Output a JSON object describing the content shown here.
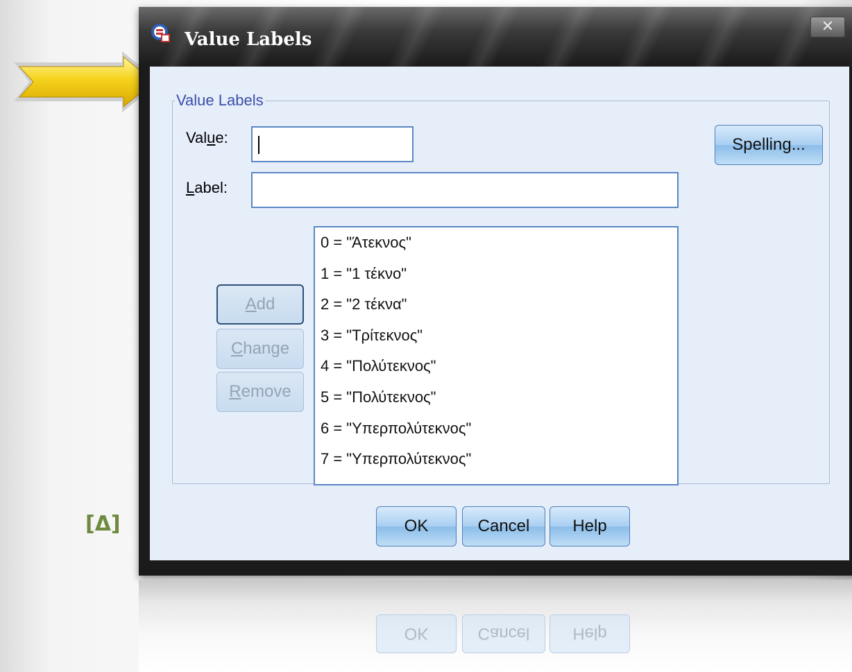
{
  "window": {
    "title": "Value Labels",
    "close_glyph": "✕",
    "icon": "spss-app-icon"
  },
  "group": {
    "legend": "Value Labels"
  },
  "value_field": {
    "label_prefix": "Val",
    "label_accel": "u",
    "label_suffix": "e:",
    "value": ""
  },
  "label_field": {
    "label_accel": "L",
    "label_rest": "abel:",
    "value": ""
  },
  "spelling_button": "Spelling...",
  "side_buttons": {
    "add": {
      "accel": "A",
      "rest": "dd"
    },
    "change": {
      "accel": "C",
      "rest": "hange"
    },
    "remove": {
      "accel": "R",
      "rest": "emove"
    }
  },
  "value_labels": [
    "0 = \"Άτεκνος\"",
    "1 = \"1 τέκνο\"",
    "2 = \"2 τέκνα\"",
    "3 = \"Τρίτεκνος\"",
    "4 = \"Πολύτεκνος\"",
    "5 = \"Πολύτεκνος\"",
    "6 = \"Υπερπολύτεκνος\"",
    "7 = \"Υπερπολύτεκνος\""
  ],
  "footer": {
    "ok": "OK",
    "cancel": "Cancel",
    "help": "Help"
  },
  "annotation": {
    "label": "[Δ]",
    "arrow_icon": "yellow-pointer-arrow-icon"
  },
  "colors": {
    "legend": "#3a4ea8",
    "button_top": "#d8ebfb",
    "button_bottom": "#8bbde9",
    "client_bg": "#e6eefa",
    "arrow": "#f5d21c",
    "annotation": "#6e8a3f"
  }
}
